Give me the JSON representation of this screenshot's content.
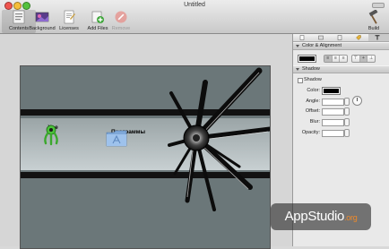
{
  "window": {
    "title": "Untitled"
  },
  "toolbar": {
    "contents": "Contents",
    "background": "Background",
    "licenses": "Licenses",
    "add_files": "Add Files",
    "remove": "Remove",
    "build": "Build"
  },
  "canvas": {
    "icons": [
      {
        "label": "Xee",
        "icon": "xee-app-icon"
      },
      {
        "label": "Программы",
        "icon": "folder-icon"
      }
    ]
  },
  "inspector": {
    "tabs": [
      "document-tab-icon",
      "window-tab-icon",
      "file-tab-icon",
      "tag-tab-icon",
      "text-tab-icon"
    ],
    "color_alignment": {
      "title": "Color & Alignment",
      "text_color": "#000000",
      "align_options": [
        "≡",
        "≡",
        "≡"
      ],
      "valign_options": [
        "⊤",
        "+",
        "⊥"
      ]
    },
    "shadow": {
      "title": "Shadow",
      "checkbox_label": "Shadow",
      "color_label": "Color:",
      "color": "#000000",
      "angle_label": "Angle:",
      "offset_label": "Offset:",
      "blur_label": "Blur:",
      "opacity_label": "Opacity:"
    }
  },
  "watermark": {
    "brand": "AppStudio",
    "tld": ".org"
  }
}
